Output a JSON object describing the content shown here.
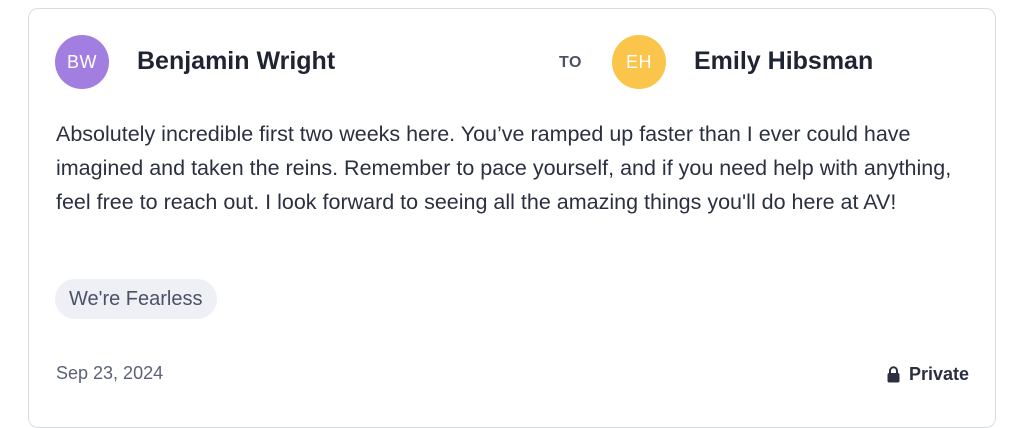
{
  "sender": {
    "initials": "BW",
    "name": "Benjamin Wright",
    "avatar_color": "#a27ee0"
  },
  "to_label": "TO",
  "recipient": {
    "initials": "EH",
    "name": "Emily Hibsman",
    "avatar_color": "#fac54a"
  },
  "message": "Absolutely incredible first two weeks here. You’ve ramped up faster than I ever could have imagined and taken the reins. Remember to pace yourself, and if you need help with anything, feel free to reach out. I look forward to seeing all the amazing things you'll do here at AV!",
  "tag": "We're Fearless",
  "date": "Sep 23, 2024",
  "privacy": {
    "icon": "lock-icon",
    "label": "Private"
  }
}
